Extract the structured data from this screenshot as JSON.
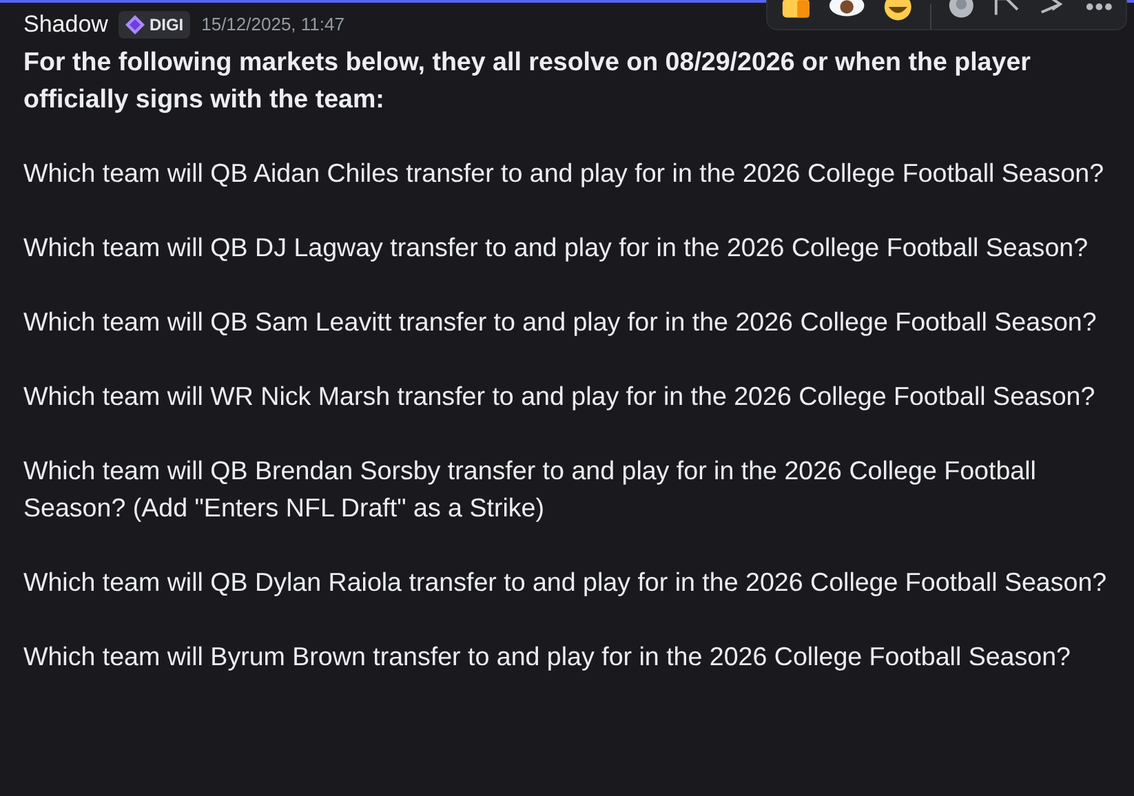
{
  "message": {
    "author": "Shadow",
    "tag": "DIGI",
    "timestamp": "15/12/2025, 11:47",
    "heading": "For the following markets below, they all resolve on 08/29/2026 or when the player officially signs with the team:",
    "paragraphs": [
      "Which team will QB Aidan Chiles transfer to and play for in the 2026 College Football Season?",
      "Which team will QB DJ Lagway transfer to and play for in the 2026 College Football Season?",
      "Which team will QB Sam Leavitt transfer to and play for in the 2026 College Football Season?",
      "Which team will WR Nick Marsh transfer to and play for in the 2026 College Football Season?",
      "Which team will QB Brendan Sorsby transfer to and play for in the 2026 College Football Season? (Add \"Enters NFL Draft\" as a Strike)",
      "Which team will QB Dylan Raiola transfer to and play for in the 2026 College Football Season?",
      "Which team will Byrum Brown transfer to and play for in the 2026 College Football Season?"
    ]
  }
}
